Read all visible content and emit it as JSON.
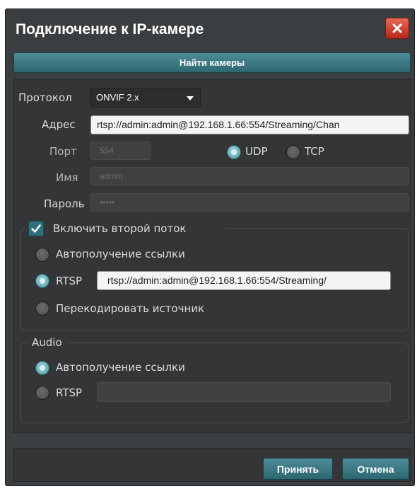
{
  "dialog": {
    "title": "Подключение к IP-камере",
    "find_button": "Найти камеры"
  },
  "form": {
    "protocol_label": "Протокол",
    "protocol_value": "ONVIF 2.x",
    "address_label": "Адрес",
    "address_value": "rtsp://admin:admin@192.168.1.66:554/Streaming/Chan",
    "port_label": "Порт",
    "port_value": "554",
    "udp_label": "UDP",
    "tcp_label": "TCP",
    "name_label": "Имя",
    "name_value": "admin",
    "password_label": "Пароль",
    "password_value": "•••••"
  },
  "second_stream": {
    "checkbox_label": "Включить второй поток",
    "checked": true,
    "auto_link_label": "Автополучение ссылки",
    "rtsp_label": "RTSP",
    "rtsp_value": "rtsp://admin:admin@192.168.1.66:554/Streaming/",
    "transcode_label": "Перекодировать источник"
  },
  "audio": {
    "group_title": "Audio",
    "auto_link_label": "Автополучение ссылки",
    "rtsp_label": "RTSP",
    "rtsp_value": ""
  },
  "footer": {
    "accept_label": "Принять",
    "cancel_label": "Отмена"
  },
  "colors": {
    "accent": "#3f7f8a",
    "close": "#c8372a",
    "dialog_bg": "#3b3e40"
  }
}
